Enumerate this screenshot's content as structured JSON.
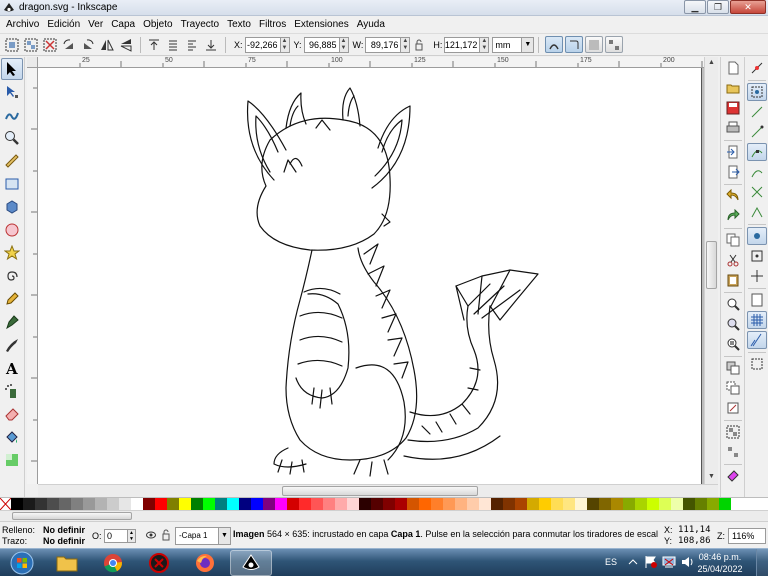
{
  "window": {
    "title": "dragon.svg - Inkscape",
    "buttons": {
      "minimize": "▁",
      "maximize": "❐",
      "close": "✕"
    }
  },
  "menubar": {
    "items": [
      {
        "label": "Archivo"
      },
      {
        "label": "Edición"
      },
      {
        "label": "Ver"
      },
      {
        "label": "Capa"
      },
      {
        "label": "Objeto"
      },
      {
        "label": "Trayecto"
      },
      {
        "label": "Texto"
      },
      {
        "label": "Filtros"
      },
      {
        "label": "Extensiones"
      },
      {
        "label": "Ayuda"
      }
    ]
  },
  "toolbar": {
    "x_label": "X:",
    "x_value": "-92,266",
    "y_label": "Y:",
    "y_value": "96,885",
    "w_label": "W:",
    "w_value": "89,176",
    "h_label": "H:",
    "h_value": "121,172",
    "unit": "mm"
  },
  "ruler": {
    "top_labels": [
      "25",
      "50",
      "75",
      "100",
      "125",
      "150",
      "175",
      "200"
    ]
  },
  "palette": {
    "colors": [
      "#000000",
      "#1a1a1a",
      "#333333",
      "#4d4d4d",
      "#666666",
      "#808080",
      "#999999",
      "#b3b3b3",
      "#cccccc",
      "#e6e6e6",
      "#ffffff",
      "#800000",
      "#ff0000",
      "#808000",
      "#ffff00",
      "#008000",
      "#00ff00",
      "#008080",
      "#00ffff",
      "#000080",
      "#0000ff",
      "#800080",
      "#ff00ff",
      "#d40000",
      "#ff2a2a",
      "#ff5555",
      "#ff8080",
      "#ffaaaa",
      "#ffd5d5",
      "#2b0000",
      "#550000",
      "#800000",
      "#aa0000",
      "#d45500",
      "#ff6600",
      "#ff7f2a",
      "#ff9955",
      "#ffb380",
      "#ffccaa",
      "#ffe6d5",
      "#552200",
      "#803300",
      "#aa4400",
      "#d4aa00",
      "#ffcc00",
      "#ffdd55",
      "#ffe680",
      "#fff6d5",
      "#554400",
      "#806600",
      "#aa8800",
      "#88aa00",
      "#aad400",
      "#ccff00",
      "#ddff55",
      "#eeffaa",
      "#445500",
      "#668000",
      "#88aa00",
      "#00d400"
    ]
  },
  "status": {
    "fill_label": "Relleno:",
    "fill_value": "No definir",
    "stroke_label": "Trazo:",
    "stroke_value": "No definir",
    "opacity_label": "O:",
    "opacity_value": "0",
    "layer": "-Capa 1",
    "message_bold": "Imagen",
    "message_1": " 564 × 635: incrustado en capa ",
    "message_layer": "Capa 1",
    "message_2": ". Pulse en la selección para conmutar los tiradores de escalad...",
    "x_label": "X:",
    "x_coord": "111,14",
    "y_label": "Y:",
    "y_coord": "108,86",
    "zoom_label": "Z:",
    "zoom": "116%"
  },
  "taskbar": {
    "language": "ES",
    "time": "08:46 p.m.",
    "date": "25/04/2022"
  }
}
